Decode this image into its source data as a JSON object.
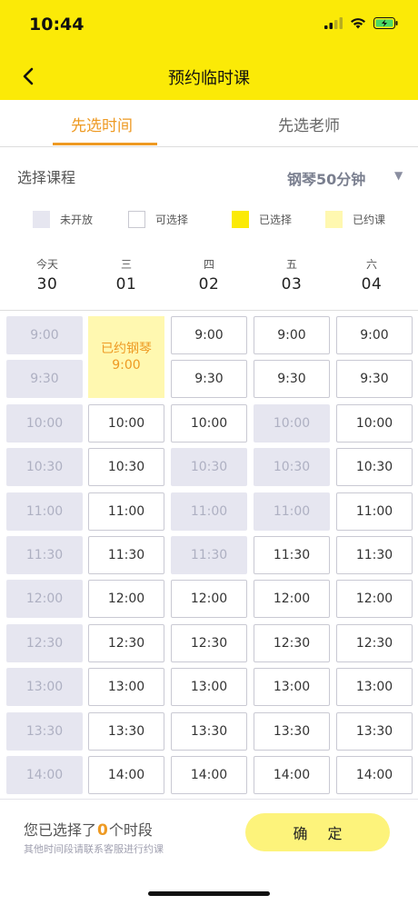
{
  "status_bar": {
    "time": "10:44"
  },
  "nav": {
    "title": "预约临时课"
  },
  "tabs": [
    {
      "label": "先选时间",
      "active": true
    },
    {
      "label": "先选老师",
      "active": false
    }
  ],
  "course": {
    "label": "选择课程",
    "value": "钢琴50分钟",
    "caret": "▼"
  },
  "legend": [
    {
      "label": "未开放",
      "state": "closed"
    },
    {
      "label": "可选择",
      "state": "open"
    },
    {
      "label": "已选择",
      "state": "selected"
    },
    {
      "label": "已约课",
      "state": "booked"
    }
  ],
  "days": [
    {
      "weekday": "今天",
      "date": "30"
    },
    {
      "weekday": "三",
      "date": "01"
    },
    {
      "weekday": "四",
      "date": "02"
    },
    {
      "weekday": "五",
      "date": "03"
    },
    {
      "weekday": "六",
      "date": "04"
    }
  ],
  "times": [
    "9:00",
    "9:30",
    "10:00",
    "10:30",
    "11:00",
    "11:30",
    "12:00",
    "12:30",
    "13:00",
    "13:30",
    "14:00"
  ],
  "booked": {
    "day": 1,
    "start_row": 0,
    "rows": 2,
    "line1": "已约钢琴",
    "line2": "9:00"
  },
  "slot_states": [
    [
      "closed",
      "closed",
      "closed",
      "closed",
      "closed",
      "closed",
      "closed",
      "closed",
      "closed",
      "closed",
      "closed"
    ],
    [
      "booked",
      "booked",
      "open",
      "open",
      "open",
      "open",
      "open",
      "open",
      "open",
      "open",
      "open"
    ],
    [
      "open",
      "open",
      "open",
      "closed",
      "closed",
      "closed",
      "open",
      "open",
      "open",
      "open",
      "open"
    ],
    [
      "open",
      "open",
      "closed",
      "closed",
      "closed",
      "open",
      "open",
      "open",
      "open",
      "open",
      "open"
    ],
    [
      "open",
      "open",
      "open",
      "open",
      "open",
      "open",
      "open",
      "open",
      "open",
      "open",
      "open"
    ]
  ],
  "footer": {
    "summary_prefix": "您已选择了",
    "selected_count": "0",
    "summary_suffix": "个时段",
    "hint": "其他时间段请联系客服进行约课",
    "confirm_label": "确定"
  },
  "colors": {
    "accent_yellow": "#fbea07",
    "accent_orange": "#ee9a23",
    "closed_gray": "#e6e6f0",
    "booked_yellow": "#fff8b0"
  }
}
